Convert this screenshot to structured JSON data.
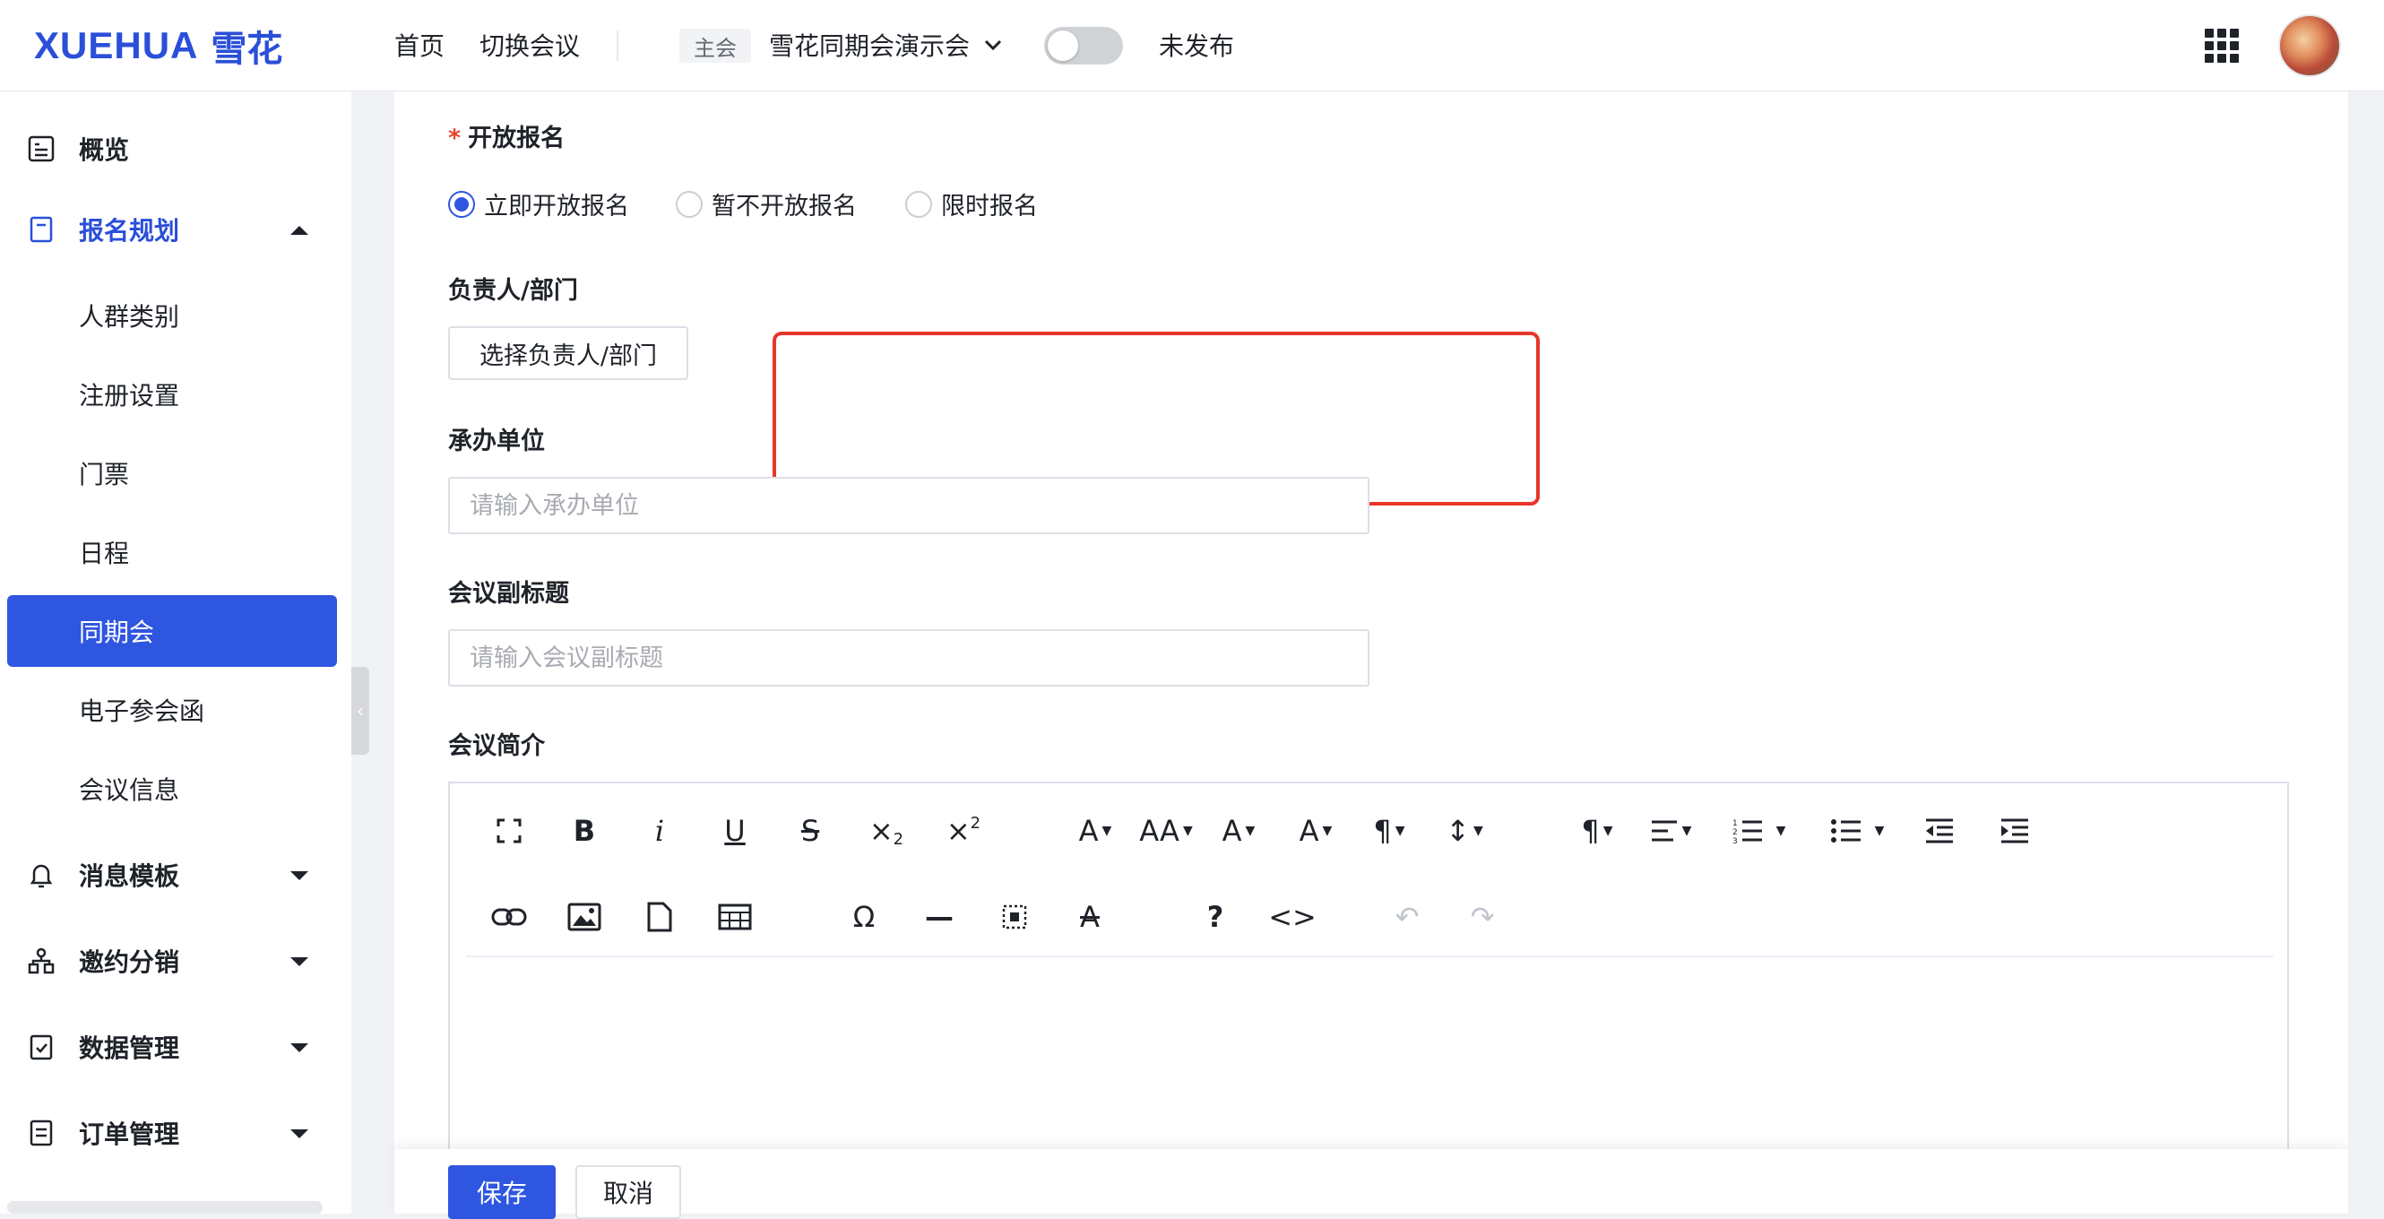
{
  "header": {
    "logo_en": "XUEHUA",
    "logo_cn": "雪花",
    "nav_home": "首页",
    "nav_switch": "切换会议",
    "conf_tag": "主会",
    "conf_name": "雪花同期会演示会",
    "publish_state": "未发布"
  },
  "sidebar": {
    "overview": "概览",
    "reg_plan": "报名规划",
    "sub_items": [
      "人群类别",
      "注册设置",
      "门票",
      "日程",
      "同期会",
      "电子参会函",
      "会议信息"
    ],
    "msg_template": "消息模板",
    "invite": "邀约分销",
    "data_mgmt": "数据管理",
    "order_mgmt": "订单管理"
  },
  "form": {
    "open_reg_label": "开放报名",
    "required_mark": "*",
    "radio_now": "立即开放报名",
    "radio_not": "暂不开放报名",
    "radio_limited": "限时报名",
    "owner_label": "负责人/部门",
    "owner_button": "选择负责人/部门",
    "organizer_label": "承办单位",
    "organizer_placeholder": "请输入承办单位",
    "subtitle_label": "会议副标题",
    "subtitle_placeholder": "请输入会议副标题",
    "intro_label": "会议简介"
  },
  "footer": {
    "save": "保存",
    "cancel": "取消"
  },
  "colors": {
    "primary": "#2f56e0",
    "logo": "#2a4fd8",
    "highlight": "#e8362a"
  }
}
